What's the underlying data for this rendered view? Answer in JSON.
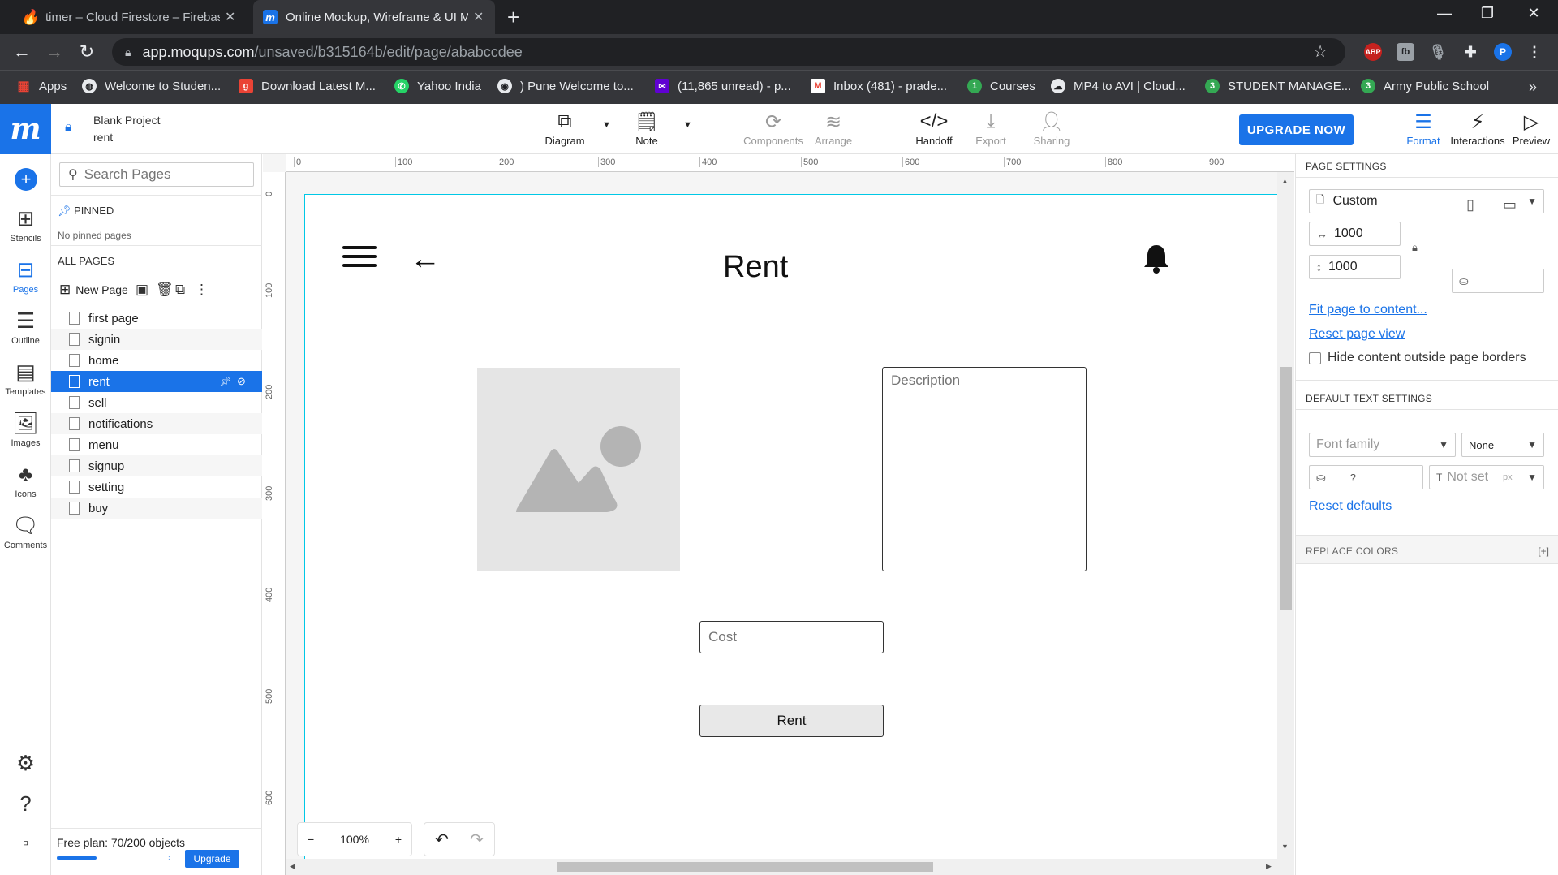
{
  "browser": {
    "tabs": [
      {
        "title": "timer – Cloud Firestore – Firebase",
        "active": false
      },
      {
        "title": "Online Mockup, Wireframe & UI Mockup",
        "active": true
      }
    ],
    "url_host": "app.moqups.com",
    "url_path": "/unsaved/b315164b/edit/page/ababccdee",
    "bookmarks": [
      "Apps",
      "Welcome to Studen...",
      "Download Latest M...",
      "Yahoo India",
      ") Pune Welcome to...",
      "(11,865 unread) - p...",
      "Inbox (481) - prade...",
      "Courses",
      "MP4 to AVI | Cloud...",
      "STUDENT MANAGE...",
      "Army Public School"
    ],
    "bookmarks_more": "»",
    "profile_initial": "P",
    "ext_abp": "ABP"
  },
  "app": {
    "project_name": "Blank Project",
    "page_name": "rent",
    "logo": "m",
    "toolbar": {
      "diagram": "Diagram",
      "note": "Note",
      "components": "Components",
      "arrange": "Arrange",
      "handoff": "Handoff",
      "export": "Export",
      "sharing": "Sharing",
      "upgrade_now": "UPGRADE NOW",
      "format": "Format",
      "interactions": "Interactions",
      "preview": "Preview"
    },
    "rail": [
      "Stencils",
      "Pages",
      "Outline",
      "Templates",
      "Images",
      "Icons",
      "Comments"
    ],
    "pages_panel": {
      "search_placeholder": "Search Pages",
      "pinned_label": "PINNED",
      "no_pinned": "No pinned pages",
      "all_pages_label": "ALL PAGES",
      "new_page": "New Page",
      "pages": [
        "first page",
        "signin",
        "home",
        "rent",
        "sell",
        "notifications",
        "menu",
        "signup",
        "setting",
        "buy"
      ],
      "selected_index": 3,
      "free_plan": "Free plan: 70/200 objects",
      "plan_used_fraction": 0.35,
      "upgrade": "Upgrade"
    },
    "rulers": {
      "top": [
        "0",
        "100",
        "200",
        "300",
        "400",
        "500",
        "600",
        "700",
        "800",
        "900"
      ],
      "left": [
        "0",
        "100",
        "200",
        "300",
        "400",
        "500",
        "600"
      ]
    },
    "mockup": {
      "title": "Rent",
      "description_placeholder": "Description",
      "cost_placeholder": "Cost",
      "rent_button": "Rent"
    },
    "zoom": {
      "minus": "−",
      "level": "100%",
      "plus": "+"
    },
    "right_panel": {
      "page_settings": "PAGE SETTINGS",
      "size_preset": "Custom",
      "width": "1000",
      "height": "1000",
      "fit_page": "Fit page to content...",
      "reset_view": "Reset page view",
      "hide_outside": "Hide content outside page borders",
      "default_text": "DEFAULT TEXT SETTINGS",
      "font_family_placeholder": "Font family",
      "font_style": "None",
      "color_value": "?",
      "size_placeholder": "Not set",
      "size_unit": "px",
      "reset_defaults": "Reset defaults",
      "replace_colors": "REPLACE COLORS",
      "replace_toggle": "[+]"
    }
  }
}
